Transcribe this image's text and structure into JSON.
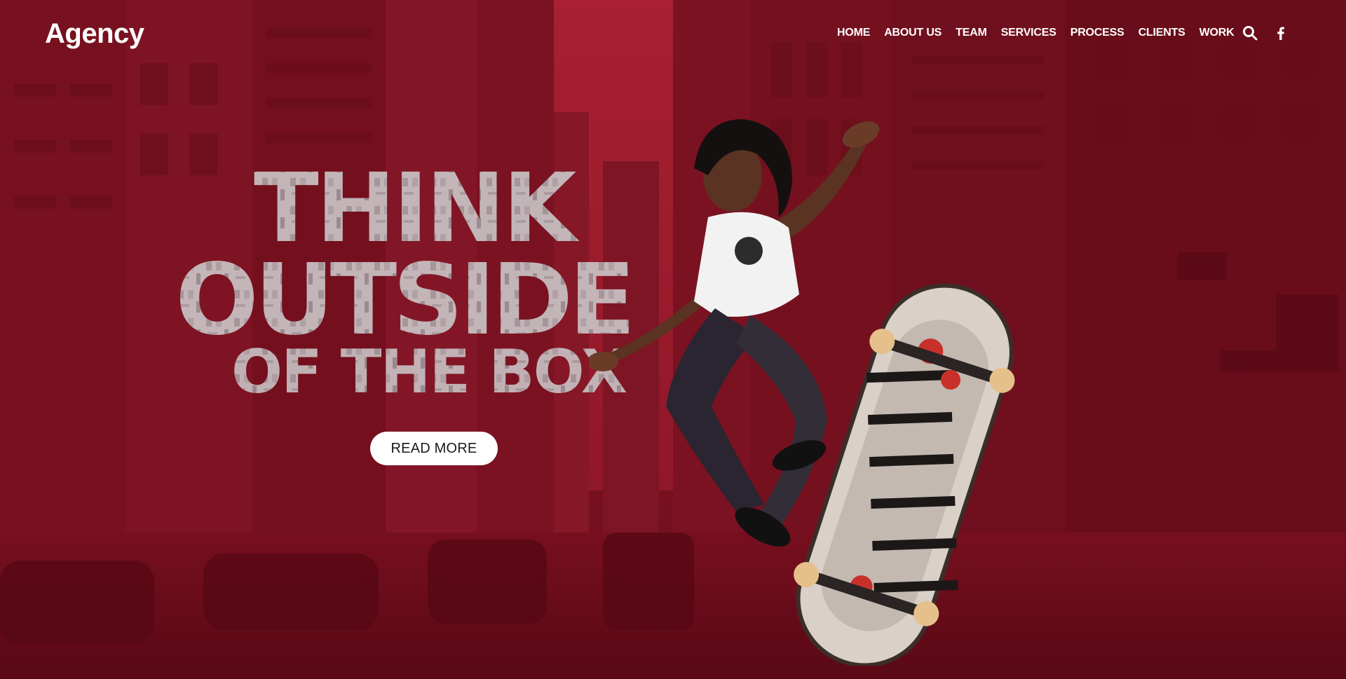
{
  "brand": {
    "logo_text": "Agency"
  },
  "nav": {
    "items": [
      {
        "label": "HOME"
      },
      {
        "label": "ABOUT US"
      },
      {
        "label": "TEAM"
      },
      {
        "label": "SERVICES"
      },
      {
        "label": "PROCESS"
      },
      {
        "label": "CLIENTS"
      },
      {
        "label": "WORK"
      }
    ]
  },
  "header_icons": [
    "search-icon",
    "facebook-icon"
  ],
  "hero": {
    "headline_line1": "THINK",
    "headline_line2": "OUTSIDE",
    "headline_line3": "OF THE BOX",
    "cta_label": "READ MORE"
  },
  "colors": {
    "background": "#8c1424",
    "text": "#ffffff",
    "button_bg": "#ffffff",
    "button_text": "#1a1a1a"
  }
}
